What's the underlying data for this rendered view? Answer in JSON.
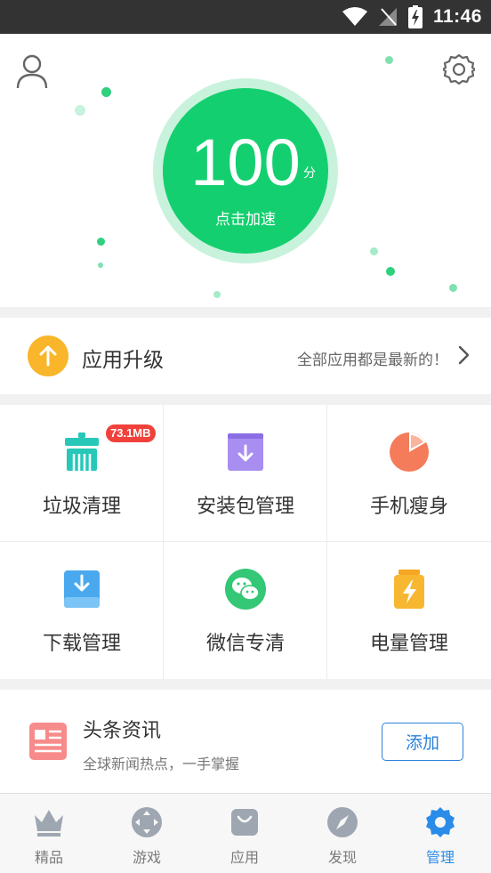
{
  "status_bar": {
    "time": "11:46"
  },
  "hero": {
    "score": "100",
    "score_unit": "分",
    "action_label": "点击加速"
  },
  "upgrade": {
    "title": "应用升级",
    "status": "全部应用都是最新的！"
  },
  "tools": [
    {
      "label": "垃圾清理",
      "icon": "trash-clean-icon",
      "badge": "73.1MB"
    },
    {
      "label": "安装包管理",
      "icon": "package-download-icon"
    },
    {
      "label": "手机瘦身",
      "icon": "pie-chart-icon"
    },
    {
      "label": "下载管理",
      "icon": "download-box-icon"
    },
    {
      "label": "微信专清",
      "icon": "wechat-icon"
    },
    {
      "label": "电量管理",
      "icon": "battery-bolt-icon"
    }
  ],
  "news": {
    "title": "头条资讯",
    "description": "全球新闻热点，一手掌握",
    "add_label": "添加"
  },
  "bottom_nav": [
    {
      "label": "精品",
      "icon": "crown-icon",
      "active": false
    },
    {
      "label": "游戏",
      "icon": "gamepad-icon",
      "active": false
    },
    {
      "label": "应用",
      "icon": "shopping-bag-icon",
      "active": false
    },
    {
      "label": "发现",
      "icon": "compass-icon",
      "active": false
    },
    {
      "label": "管理",
      "icon": "gear-icon",
      "active": true
    }
  ],
  "colors": {
    "accent_green": "#14cf6f",
    "active_blue": "#2a8ce8",
    "badge_red": "#f0413a",
    "upgrade_orange": "#f9b62a"
  }
}
